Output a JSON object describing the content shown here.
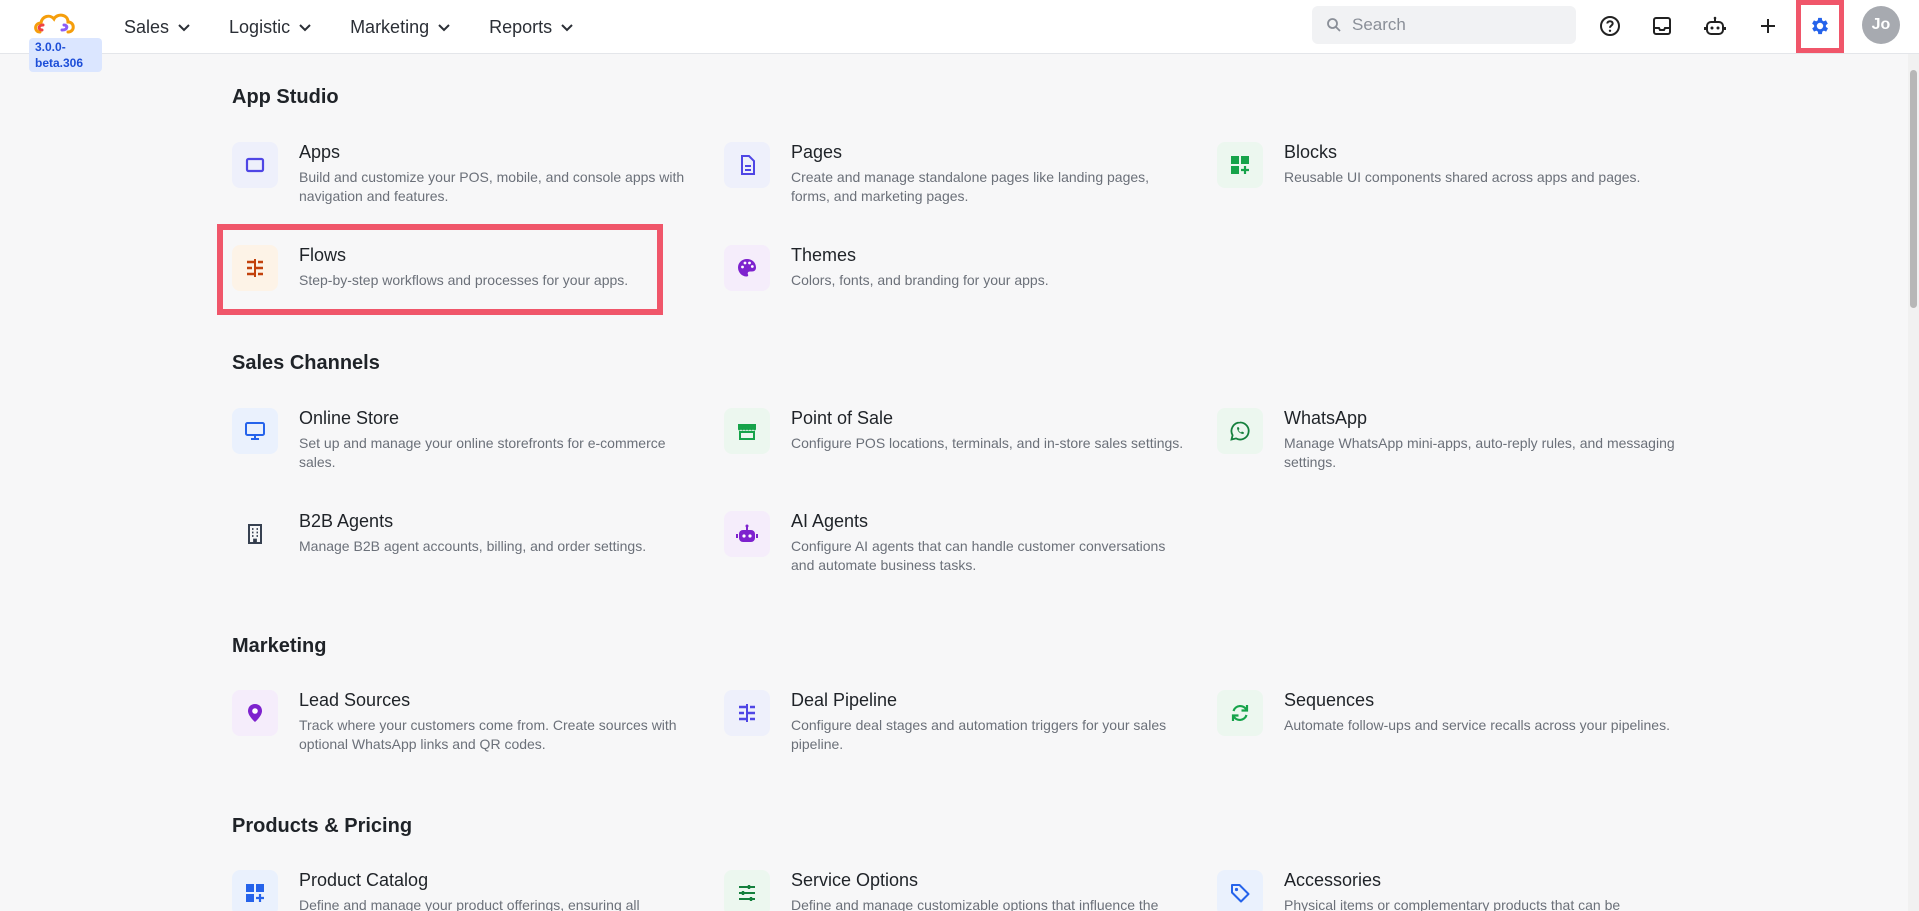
{
  "app": {
    "version": "3.0.0-beta.306"
  },
  "nav": [
    "Sales",
    "Logistic",
    "Marketing",
    "Reports"
  ],
  "search": {
    "placeholder": "Search"
  },
  "user": {
    "initials": "Jo"
  },
  "sections": [
    {
      "title": "App Studio",
      "items": [
        {
          "title": "Apps",
          "desc": "Build and customize your POS, mobile, and console apps with navigation and features.",
          "icon": "apps-icon"
        },
        {
          "title": "Pages",
          "desc": "Create and manage standalone pages like landing pages, forms, and marketing pages.",
          "icon": "page-icon"
        },
        {
          "title": "Blocks",
          "desc": "Reusable UI components shared across apps and pages.",
          "icon": "blocks-icon"
        },
        {
          "title": "Flows",
          "desc": "Step-by-step workflows and processes for your apps.",
          "icon": "flows-icon"
        },
        {
          "title": "Themes",
          "desc": "Colors, fonts, and branding for your apps.",
          "icon": "palette-icon"
        }
      ]
    },
    {
      "title": "Sales Channels",
      "items": [
        {
          "title": "Online Store",
          "desc": "Set up and manage your online storefronts for e-commerce sales.",
          "icon": "monitor-icon"
        },
        {
          "title": "Point of Sale",
          "desc": "Configure POS locations, terminals, and in-store sales settings.",
          "icon": "store-icon"
        },
        {
          "title": "WhatsApp",
          "desc": "Manage WhatsApp mini-apps, auto-reply rules, and messaging settings.",
          "icon": "whatsapp-icon"
        },
        {
          "title": "B2B Agents",
          "desc": "Manage B2B agent accounts, billing, and order settings.",
          "icon": "building-icon"
        },
        {
          "title": "AI Agents",
          "desc": "Configure AI agents that can handle customer conversations and automate business tasks.",
          "icon": "robot-icon"
        }
      ]
    },
    {
      "title": "Marketing",
      "items": [
        {
          "title": "Lead Sources",
          "desc": "Track where your customers come from. Create sources with optional WhatsApp links and QR codes.",
          "icon": "location-icon"
        },
        {
          "title": "Deal Pipeline",
          "desc": "Configure deal stages and automation triggers for your sales pipeline.",
          "icon": "pipeline-icon"
        },
        {
          "title": "Sequences",
          "desc": "Automate follow-ups and service recalls across your pipelines.",
          "icon": "refresh-icon"
        }
      ]
    },
    {
      "title": "Products & Pricing",
      "items": [
        {
          "title": "Product Catalog",
          "desc": "Define and manage your product offerings, ensuring all",
          "icon": "catalog-icon"
        },
        {
          "title": "Service Options",
          "desc": "Define and manage customizable options that influence the",
          "icon": "sliders-icon"
        },
        {
          "title": "Accessories",
          "desc": "Physical items or complementary products that can be",
          "icon": "tag-icon"
        }
      ]
    }
  ],
  "colors": {
    "accent": "#2563eb",
    "highlight": "#f0566a",
    "blue_icon": "#4f46e5",
    "green_icon": "#16a34a",
    "orange_icon": "#c2410c",
    "purple_icon": "#7e22ce"
  }
}
